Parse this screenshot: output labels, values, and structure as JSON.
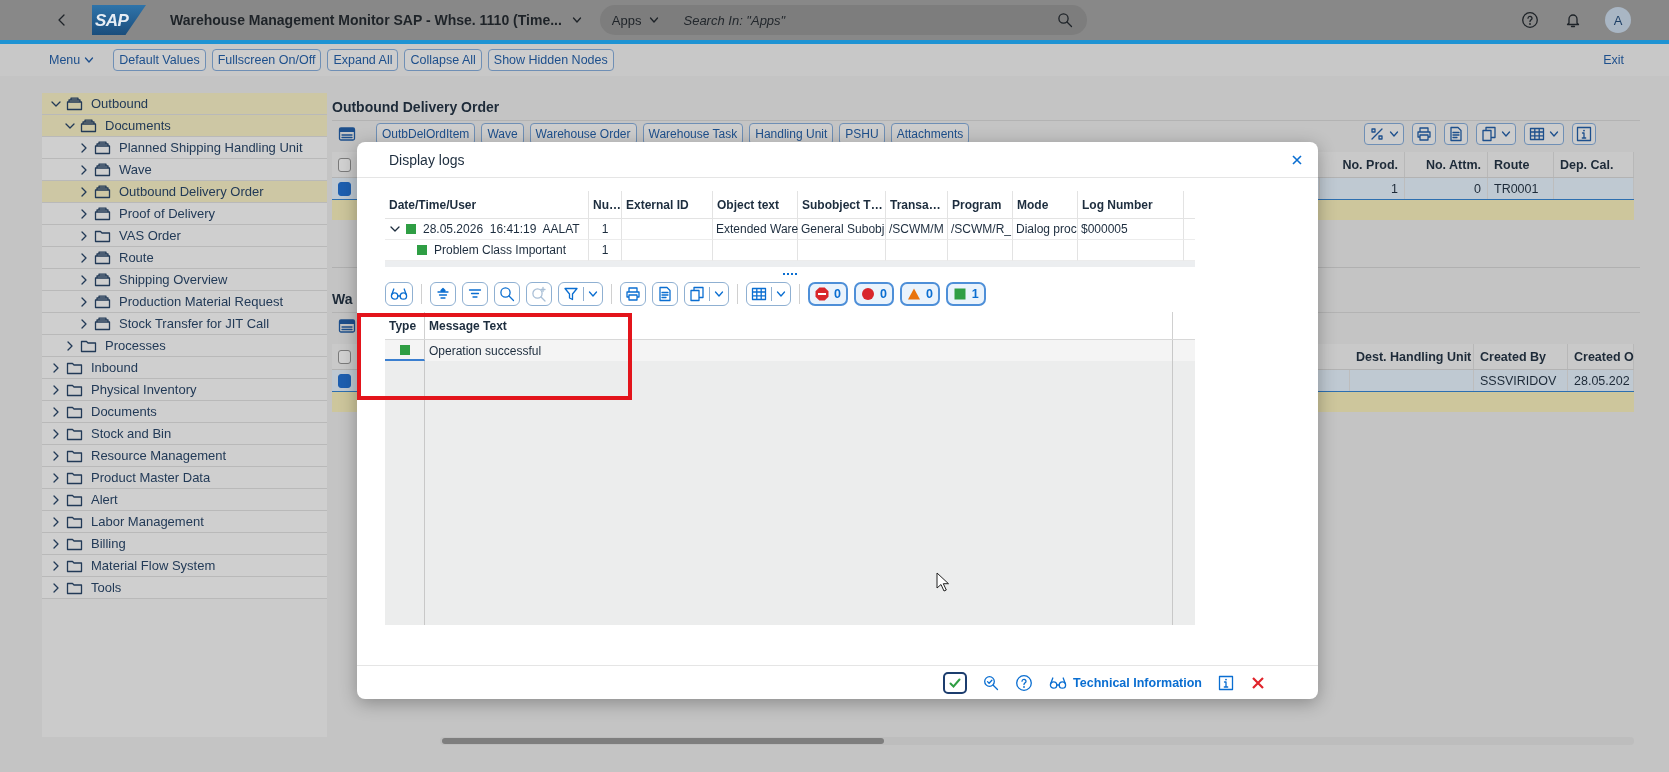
{
  "shell": {
    "logo": "SAP",
    "title": "Warehouse Management Monitor SAP - Whse. 1110 (Time...",
    "search": {
      "scope": "Apps",
      "placeholder": "Search In: \"Apps\""
    },
    "avatar": "A"
  },
  "toolbar": {
    "menu": "Menu",
    "buttons": [
      "Default Values",
      "Fullscreen On/Off",
      "Expand All",
      "Collapse All",
      "Show Hidden Nodes"
    ],
    "exit": "Exit"
  },
  "tree": [
    {
      "label": "Outbound",
      "kind": "node",
      "expanded": true,
      "selected": true,
      "children": [
        {
          "label": "Documents",
          "kind": "node",
          "expanded": true,
          "selected": true,
          "children": [
            {
              "label": "Planned Shipping Handling Unit",
              "kind": "node",
              "expanded": false,
              "selected": false
            },
            {
              "label": "Wave",
              "kind": "node",
              "expanded": false,
              "selected": false
            },
            {
              "label": "Outbound Delivery Order",
              "kind": "node",
              "expanded": false,
              "selected": true
            },
            {
              "label": "Proof of Delivery",
              "kind": "node",
              "expanded": false,
              "selected": false
            },
            {
              "label": "VAS Order",
              "kind": "folder",
              "expanded": false,
              "selected": false
            },
            {
              "label": "Route",
              "kind": "node",
              "expanded": false,
              "selected": false
            },
            {
              "label": "Shipping Overview",
              "kind": "node",
              "expanded": false,
              "selected": false
            },
            {
              "label": "Production Material Request",
              "kind": "node",
              "expanded": false,
              "selected": false
            },
            {
              "label": "Stock Transfer for JIT Call",
              "kind": "node",
              "expanded": false,
              "selected": false
            }
          ]
        },
        {
          "label": "Processes",
          "kind": "folder",
          "expanded": false,
          "selected": false
        }
      ]
    },
    {
      "label": "Inbound",
      "kind": "folder",
      "expanded": false,
      "selected": false
    },
    {
      "label": "Physical Inventory",
      "kind": "folder",
      "expanded": false,
      "selected": false
    },
    {
      "label": "Documents",
      "kind": "folder",
      "expanded": false,
      "selected": false
    },
    {
      "label": "Stock and Bin",
      "kind": "folder",
      "expanded": false,
      "selected": false
    },
    {
      "label": "Resource Management",
      "kind": "folder",
      "expanded": false,
      "selected": false
    },
    {
      "label": "Product Master Data",
      "kind": "folder",
      "expanded": false,
      "selected": false
    },
    {
      "label": "Alert",
      "kind": "folder",
      "expanded": false,
      "selected": false
    },
    {
      "label": "Labor Management",
      "kind": "folder",
      "expanded": false,
      "selected": false
    },
    {
      "label": "Billing",
      "kind": "folder",
      "expanded": false,
      "selected": false
    },
    {
      "label": "Material Flow System",
      "kind": "folder",
      "expanded": false,
      "selected": false
    },
    {
      "label": "Tools",
      "kind": "folder",
      "expanded": false,
      "selected": false
    }
  ],
  "delivery_orders": {
    "title": "Outbound Delivery Order",
    "toolbar_buttons": [
      "OutbDelOrdItem",
      "Wave",
      "Warehouse Order",
      "Warehouse Task",
      "Handling Unit",
      "PSHU",
      "Attachments"
    ],
    "columns": [
      "No. Prod.",
      "No. Attm.",
      "Route",
      "Dep. Cal."
    ],
    "select_all": false,
    "rows": [
      {
        "selected": true,
        "no_prod": "1",
        "no_attm": "0",
        "route": "TR0001"
      }
    ]
  },
  "warehouse_tasks": {
    "title": "Wa",
    "columns": [
      "Dest. Handling Unit",
      "Created By",
      "Created O"
    ],
    "select_all": false,
    "rows": [
      {
        "selected": true,
        "created_by": "SSSVIRIDOV",
        "created_on": "28.05.202"
      }
    ]
  },
  "dialog": {
    "title": "Display logs",
    "log_table": {
      "columns": [
        "Date/Time/User",
        "Nu…",
        "External ID",
        "Object text",
        "Subobject T…",
        "Transa…",
        "Program",
        "Mode",
        "Log Number"
      ],
      "rows": [
        {
          "expanded": true,
          "color": "#2f9e44",
          "date_time_user": "28.05.2026  16:41:19  AALAT",
          "number": "1",
          "object_text": "Extended Ware",
          "subobject_text": "General Subobj",
          "transaction": "/SCWM/M",
          "program": "/SCWM/R_",
          "mode": "Dialog proc",
          "log_number": "$000005",
          "children": [
            {
              "color": "#2f9e44",
              "date_time_user": "Problem Class Important",
              "number": "1"
            }
          ]
        }
      ]
    },
    "status_filters": [
      {
        "kind": "stop",
        "count": "0"
      },
      {
        "kind": "error",
        "count": "0"
      },
      {
        "kind": "warning",
        "count": "0"
      },
      {
        "kind": "success",
        "count": "1"
      }
    ],
    "message_table": {
      "columns": [
        "Type",
        "Message Text"
      ],
      "rows": [
        {
          "color": "#2f9e44",
          "message_text": "Operation successful"
        }
      ]
    },
    "footer_link": "Technical Information"
  },
  "annotation": {
    "kind": "frame"
  }
}
